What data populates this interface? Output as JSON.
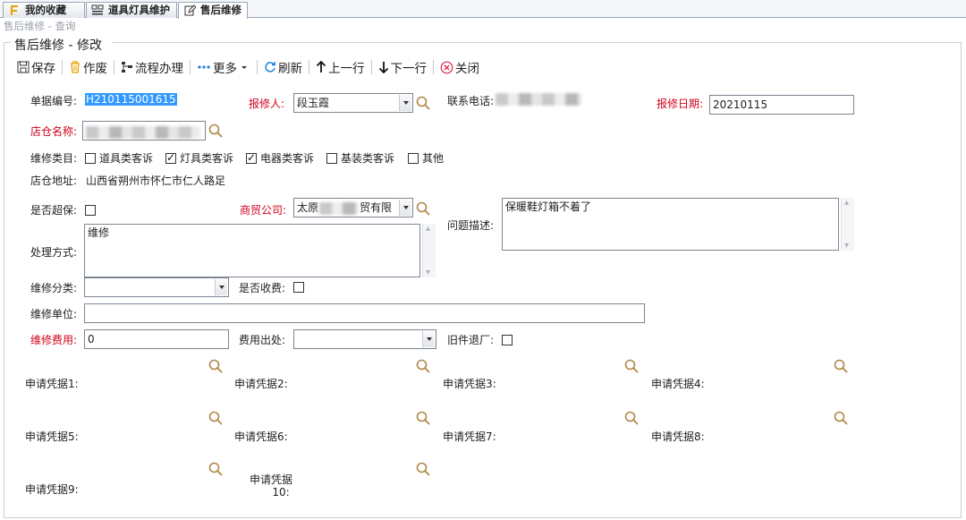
{
  "tabs": [
    {
      "label": "我的收藏",
      "icon": "favorites-icon"
    },
    {
      "label": "道具灯具维护",
      "icon": "grid-icon"
    },
    {
      "label": "售后维修",
      "icon": "edit-icon"
    }
  ],
  "breadcrumb": "售后维修 - 查询",
  "frame_title": "售后维修 - 修改",
  "toolbar": {
    "save": "保存",
    "void": "作废",
    "process": "流程办理",
    "more": "更多",
    "refresh": "刷新",
    "prev": "上一行",
    "next": "下一行",
    "close": "关闭"
  },
  "form": {
    "doc_no": {
      "label": "单据编号:",
      "value": "H210115001615"
    },
    "reporter": {
      "label": "报修人:",
      "value": "段玉霞"
    },
    "phone": {
      "label": "联系电话:"
    },
    "report_date": {
      "label": "报修日期:",
      "value": "20210115"
    },
    "store_name": {
      "label": "店仓名称:"
    },
    "repair_type": {
      "label": "维修类目:",
      "options": [
        {
          "label": "道具类客诉",
          "checked": false
        },
        {
          "label": "灯具类客诉",
          "checked": true
        },
        {
          "label": "电器类客诉",
          "checked": true
        },
        {
          "label": "基装类客诉",
          "checked": false
        },
        {
          "label": "其他",
          "checked": false
        }
      ]
    },
    "store_address": {
      "label": "店仓地址:",
      "value": "山西省朔州市怀仁市仁人路足"
    },
    "over_warranty": {
      "label": "是否超保:",
      "checked": false
    },
    "trade_company": {
      "label": "商贸公司:",
      "value_prefix": "太原",
      "value_suffix": "贸有限"
    },
    "problem": {
      "label": "问题描述:",
      "value": "保暖鞋灯箱不着了"
    },
    "handling": {
      "label": "处理方式:",
      "value": "维修"
    },
    "repair_category": {
      "label": "维修分类:",
      "value": ""
    },
    "charged": {
      "label": "是否收费:",
      "checked": false
    },
    "repair_unit": {
      "label": "维修单位:",
      "value": ""
    },
    "repair_fee": {
      "label": "维修费用:",
      "value": "0"
    },
    "fee_source": {
      "label": "费用出处:",
      "value": ""
    },
    "old_return": {
      "label": "旧件退厂:",
      "checked": false
    },
    "vouchers": [
      "申请凭据1:",
      "申请凭据2:",
      "申请凭据3:",
      "申请凭据4:",
      "申请凭据5:",
      "申请凭据6:",
      "申请凭据7:",
      "申请凭据8:",
      "申请凭据9:"
    ],
    "voucher10": {
      "line1": "申请凭据",
      "line2": "10:"
    }
  },
  "colors": {
    "required_label": "#d0021b",
    "selection": "#3399ff",
    "search_icon": "#b0874a"
  }
}
